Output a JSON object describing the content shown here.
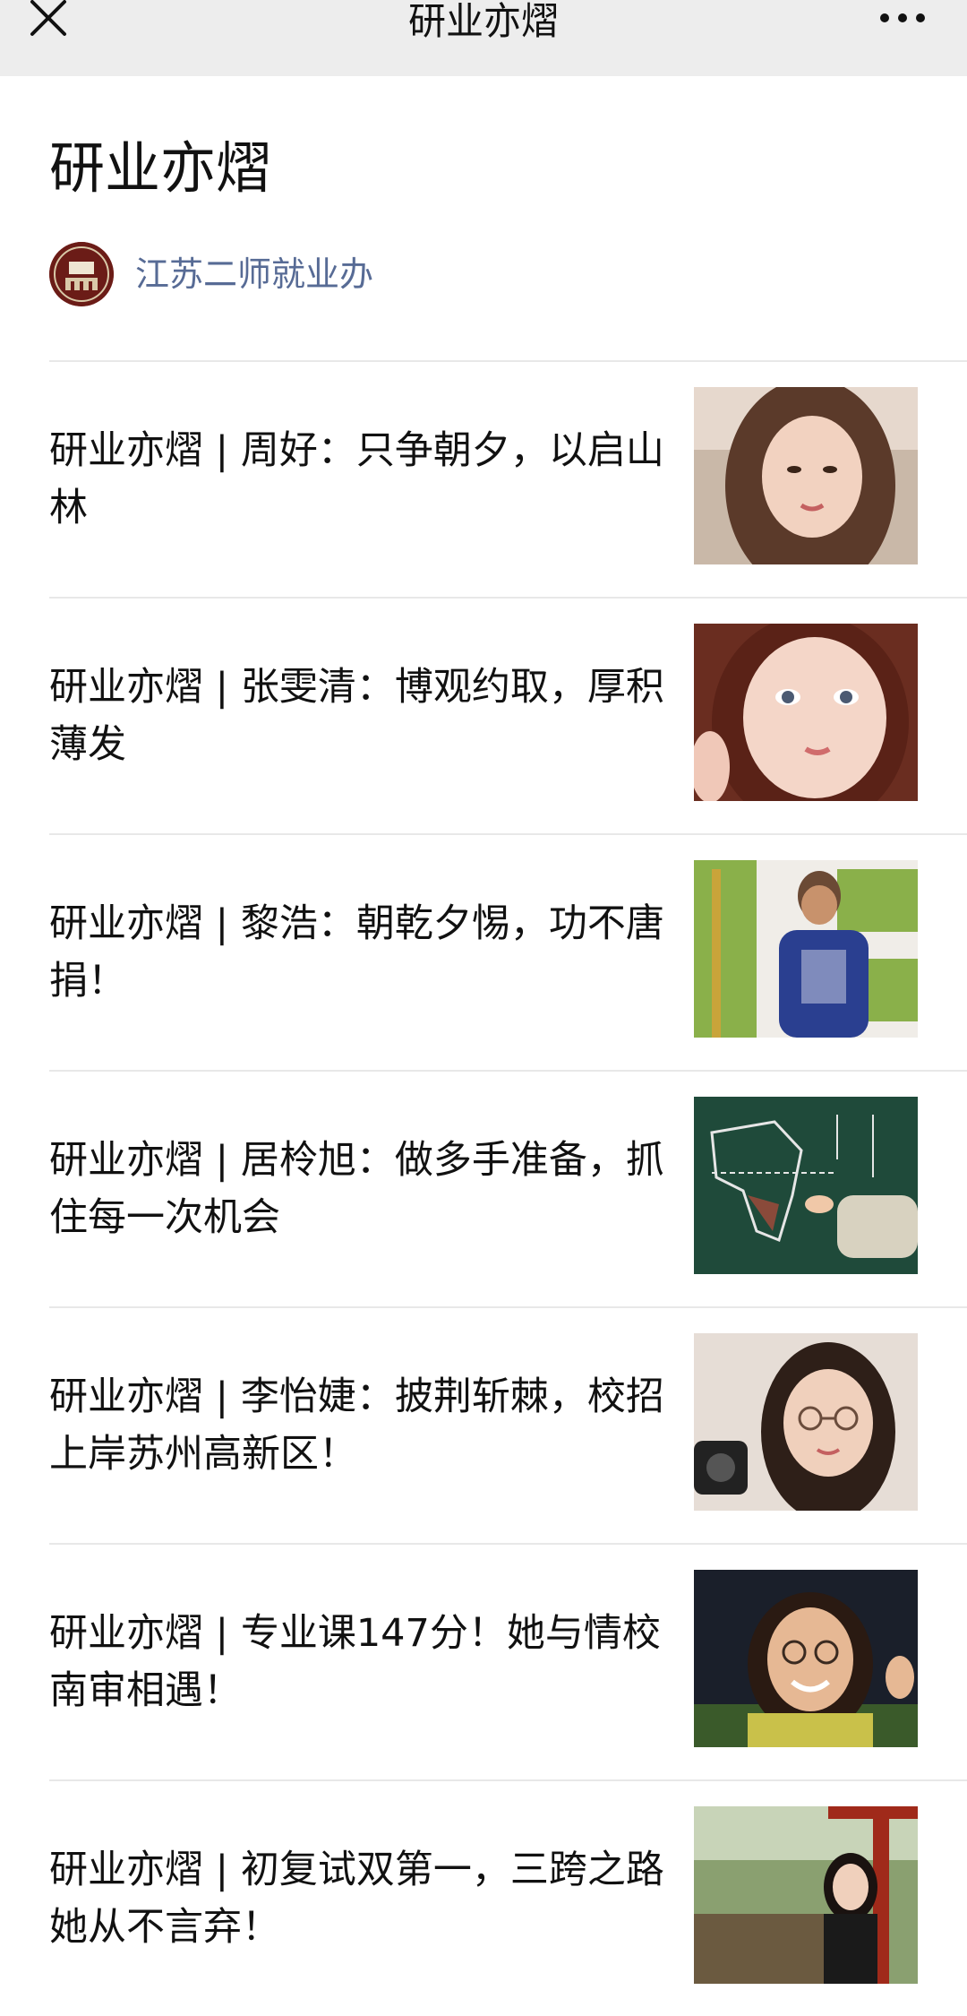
{
  "nav": {
    "title": "研业亦熠",
    "close_icon": "close-icon",
    "more_icon": "more-icon"
  },
  "header": {
    "title": "研业亦熠",
    "account_name": "江苏二师就业办",
    "avatar_icon": "school-logo"
  },
  "articles": [
    {
      "title": "研业亦熠 | 周好：只争朝夕，以启山林"
    },
    {
      "title": "研业亦熠 | 张雯清：博观约取，厚积薄发"
    },
    {
      "title": "研业亦熠 | 黎浩：朝乾夕惕，功不唐捐！"
    },
    {
      "title": "研业亦熠 | 居柃旭：做多手准备，抓住每一次机会"
    },
    {
      "title": "研业亦熠 | 李怡婕：披荆斩棘，校招上岸苏州高新区！"
    },
    {
      "title": "研业亦熠 | 专业课147分！她与情校南审相遇！"
    },
    {
      "title": "研业亦熠 | 初复试双第一，三跨之路她从不言弃！"
    }
  ],
  "colors": {
    "link": "#576b95",
    "nav_bg": "#ededed",
    "divider": "#e8e8e8"
  }
}
